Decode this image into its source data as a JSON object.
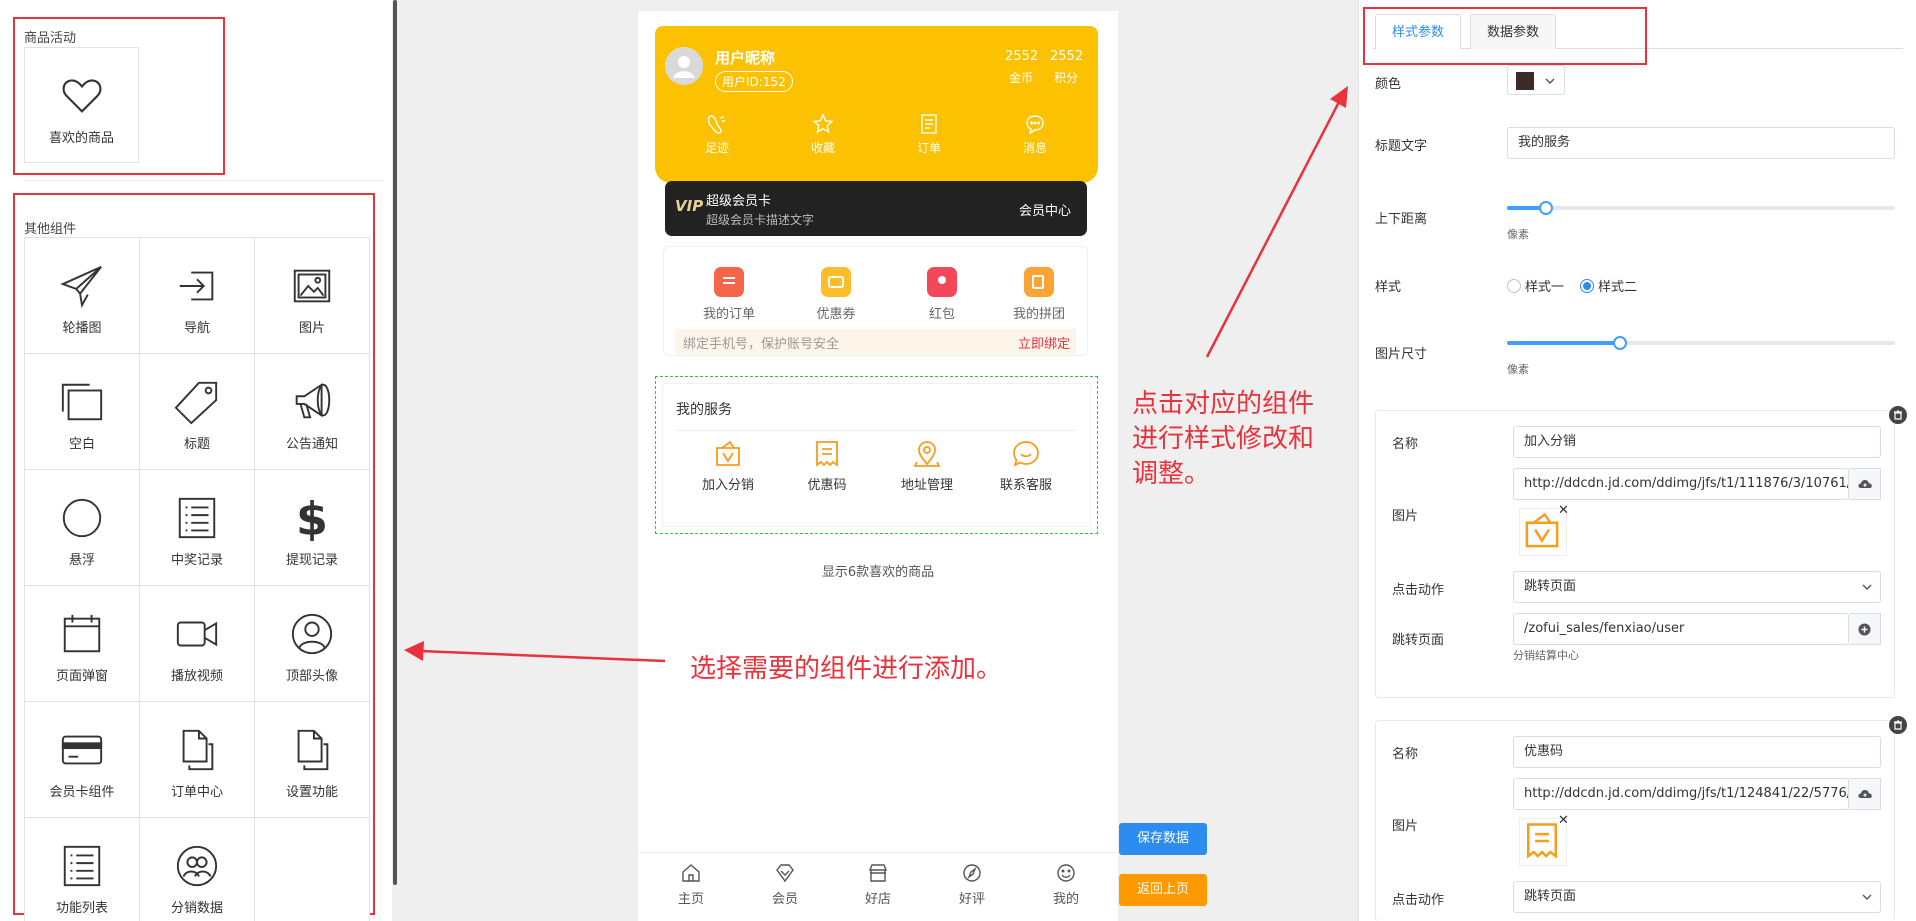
{
  "left_panel": {
    "activity_title": "商品活动",
    "activity_items": [
      {
        "label": "喜欢的商品",
        "icon": "heart-icon"
      }
    ],
    "other_title": "其他组件",
    "other_items": [
      {
        "label": "轮播图",
        "icon": "paper-plane-icon"
      },
      {
        "label": "导航",
        "icon": "sign-in-icon"
      },
      {
        "label": "图片",
        "icon": "image-icon"
      },
      {
        "label": "空白",
        "icon": "clone-icon"
      },
      {
        "label": "标题",
        "icon": "tag-icon"
      },
      {
        "label": "公告通知",
        "icon": "megaphone-icon"
      },
      {
        "label": "悬浮",
        "icon": "circle-icon"
      },
      {
        "label": "中奖记录",
        "icon": "list-icon"
      },
      {
        "label": "提现记录",
        "icon": "dollar-icon"
      },
      {
        "label": "页面弹窗",
        "icon": "calendar-icon"
      },
      {
        "label": "播放视频",
        "icon": "video-icon"
      },
      {
        "label": "顶部头像",
        "icon": "user-circle-icon"
      },
      {
        "label": "会员卡组件",
        "icon": "credit-card-icon"
      },
      {
        "label": "订单中心",
        "icon": "files-icon"
      },
      {
        "label": "设置功能",
        "icon": "file-icon"
      },
      {
        "label": "功能列表",
        "icon": "list-icon"
      },
      {
        "label": "分销数据",
        "icon": "users-icon"
      }
    ]
  },
  "preview": {
    "header": {
      "nickname": "用户昵称",
      "user_id": "用户ID:152",
      "coins_value": "2552",
      "coins_label": "金币",
      "points_value": "2552",
      "points_label": "积分",
      "colors": {
        "bg": "#fcc100"
      },
      "icons": [
        {
          "label": "足迹",
          "icon": "footprint-icon"
        },
        {
          "label": "收藏",
          "icon": "star-icon"
        },
        {
          "label": "订单",
          "icon": "document-icon"
        },
        {
          "label": "消息",
          "icon": "chat-icon"
        }
      ]
    },
    "vip": {
      "badge": "VIP",
      "title": "超级会员卡",
      "desc": "超级会员卡描述文字",
      "center": "会员中心"
    },
    "orders": [
      {
        "label": "我的订单",
        "color": "#f5654a"
      },
      {
        "label": "优惠券",
        "color": "#fcbd2b"
      },
      {
        "label": "红包",
        "color": "#f5475a"
      },
      {
        "label": "我的拼团",
        "color": "#fca336"
      }
    ],
    "bind": {
      "text": "绑定手机号，保护账号安全",
      "action": "立即绑定"
    },
    "service": {
      "title": "我的服务",
      "items": [
        {
          "label": "加入分销",
          "icon": "distribution-icon"
        },
        {
          "label": "优惠码",
          "icon": "coupon-code-icon"
        },
        {
          "label": "地址管理",
          "icon": "location-icon"
        },
        {
          "label": "联系客服",
          "icon": "service-chat-icon"
        }
      ]
    },
    "fav_text": "显示6款喜欢的商品",
    "tabs": [
      {
        "label": "主页",
        "icon": "home-icon"
      },
      {
        "label": "会员",
        "icon": "diamond-icon"
      },
      {
        "label": "好店",
        "icon": "shop-icon"
      },
      {
        "label": "好评",
        "icon": "compass-icon"
      },
      {
        "label": "我的",
        "icon": "smile-icon"
      }
    ]
  },
  "buttons": {
    "save": "保存数据",
    "back": "返回上页",
    "colors": {
      "save": "#2d8cf0",
      "back": "#ff9900"
    }
  },
  "annotations": {
    "select": "选择需要的组件进行添加。",
    "click_lines": [
      "点击对应的组件",
      "进行样式修改和",
      "调整。"
    ],
    "color": "#e8323c"
  },
  "right_panel": {
    "tabs": [
      "样式参数",
      "数据参数"
    ],
    "active_tab": 0,
    "color_label": "颜色",
    "color_value": "#3d2b2b",
    "title_label": "标题文字",
    "title_value": "我的服务",
    "margin_label": "上下距离",
    "margin_value": 0.1,
    "unit": "像素",
    "style_label": "样式",
    "style_options": [
      "样式一",
      "样式二"
    ],
    "style_selected": 1,
    "img_size_label": "图片尺寸",
    "img_size_value": 0.29,
    "cards": [
      {
        "name_label": "名称",
        "name_value": "加入分销",
        "img_label": "图片",
        "img_url": "http://ddcdn.jd.com/ddimg/jfs/t1/111876/3/10761/44",
        "img_icon": "distribution-icon",
        "action_label": "点击动作",
        "action_value": "跳转页面",
        "jump_label": "跳转页面",
        "jump_value": "/zofui_sales/fenxiao/user",
        "jump_hint": "分销结算中心"
      },
      {
        "name_label": "名称",
        "name_value": "优惠码",
        "img_label": "图片",
        "img_url": "http://ddcdn.jd.com/ddimg/jfs/t1/124841/22/5776/40",
        "img_icon": "coupon-code-icon",
        "action_label": "点击动作",
        "action_value": "跳转页面"
      }
    ]
  }
}
